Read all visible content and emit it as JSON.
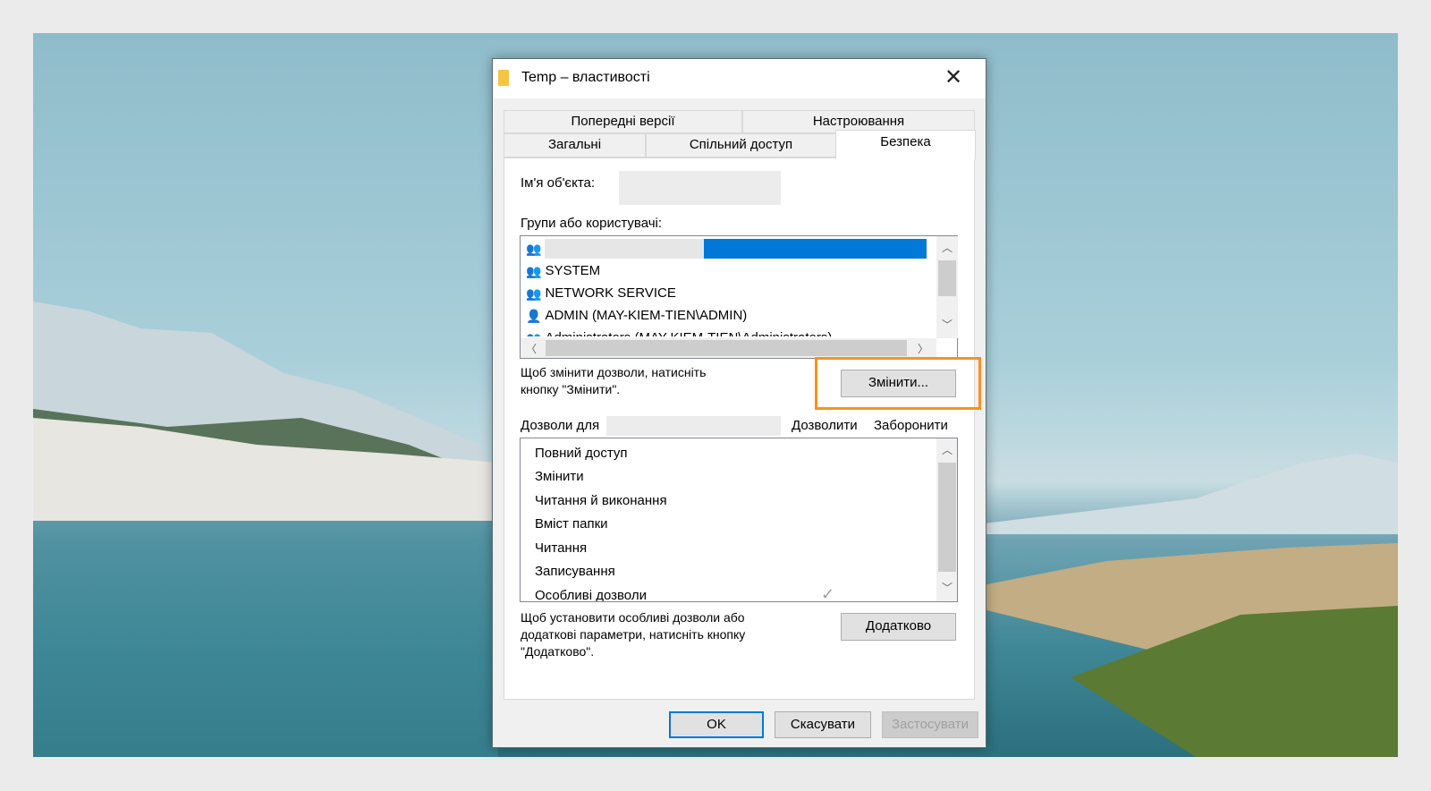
{
  "window": {
    "title": "Temp – властивості",
    "close_icon": "close-icon",
    "folder_icon": "folder-icon"
  },
  "tabs": {
    "row1": [
      "Попередні версії",
      "Настроювання"
    ],
    "row2": [
      "Загальні",
      "Спільний доступ",
      "Безпека"
    ],
    "active": "Безпека"
  },
  "object_name_label": "Ім'я об'єкта:",
  "groups_label": "Групи або користувачі:",
  "users": [
    {
      "name": "",
      "icon": "group-icon",
      "selected": true
    },
    {
      "name": "SYSTEM",
      "icon": "group-icon"
    },
    {
      "name": "NETWORK SERVICE",
      "icon": "group-icon"
    },
    {
      "name": "ADMIN (MAY-KIEM-TIEN\\ADMIN)",
      "icon": "user-icon"
    },
    {
      "name": "Administrators (MAY-KIEM-TIEN\\Administrators)",
      "icon": "group-icon"
    }
  ],
  "change_hint": [
    "Щоб змінити дозволи, натисніть",
    "кнопку \"Змінити\"."
  ],
  "change_button": "Змінити...",
  "permissions_for_label": "Дозволи для",
  "allow_header": "Дозволити",
  "deny_header": "Заборонити",
  "permissions": [
    "Повний доступ",
    "Змінити",
    "Читання й виконання",
    "Вміст папки",
    "Читання",
    "Записування",
    "Особливі дозволи"
  ],
  "advanced_hint": [
    "Щоб установити особливі дозволи або",
    "додаткові параметри, натисніть кнопку",
    "\"Додатково\"."
  ],
  "advanced_button": "Додатково",
  "buttons": {
    "ok": "OK",
    "cancel": "Скасувати",
    "apply": "Застосувати"
  },
  "colors": {
    "selection": "#0078d7",
    "highlight": "#f7931e"
  }
}
